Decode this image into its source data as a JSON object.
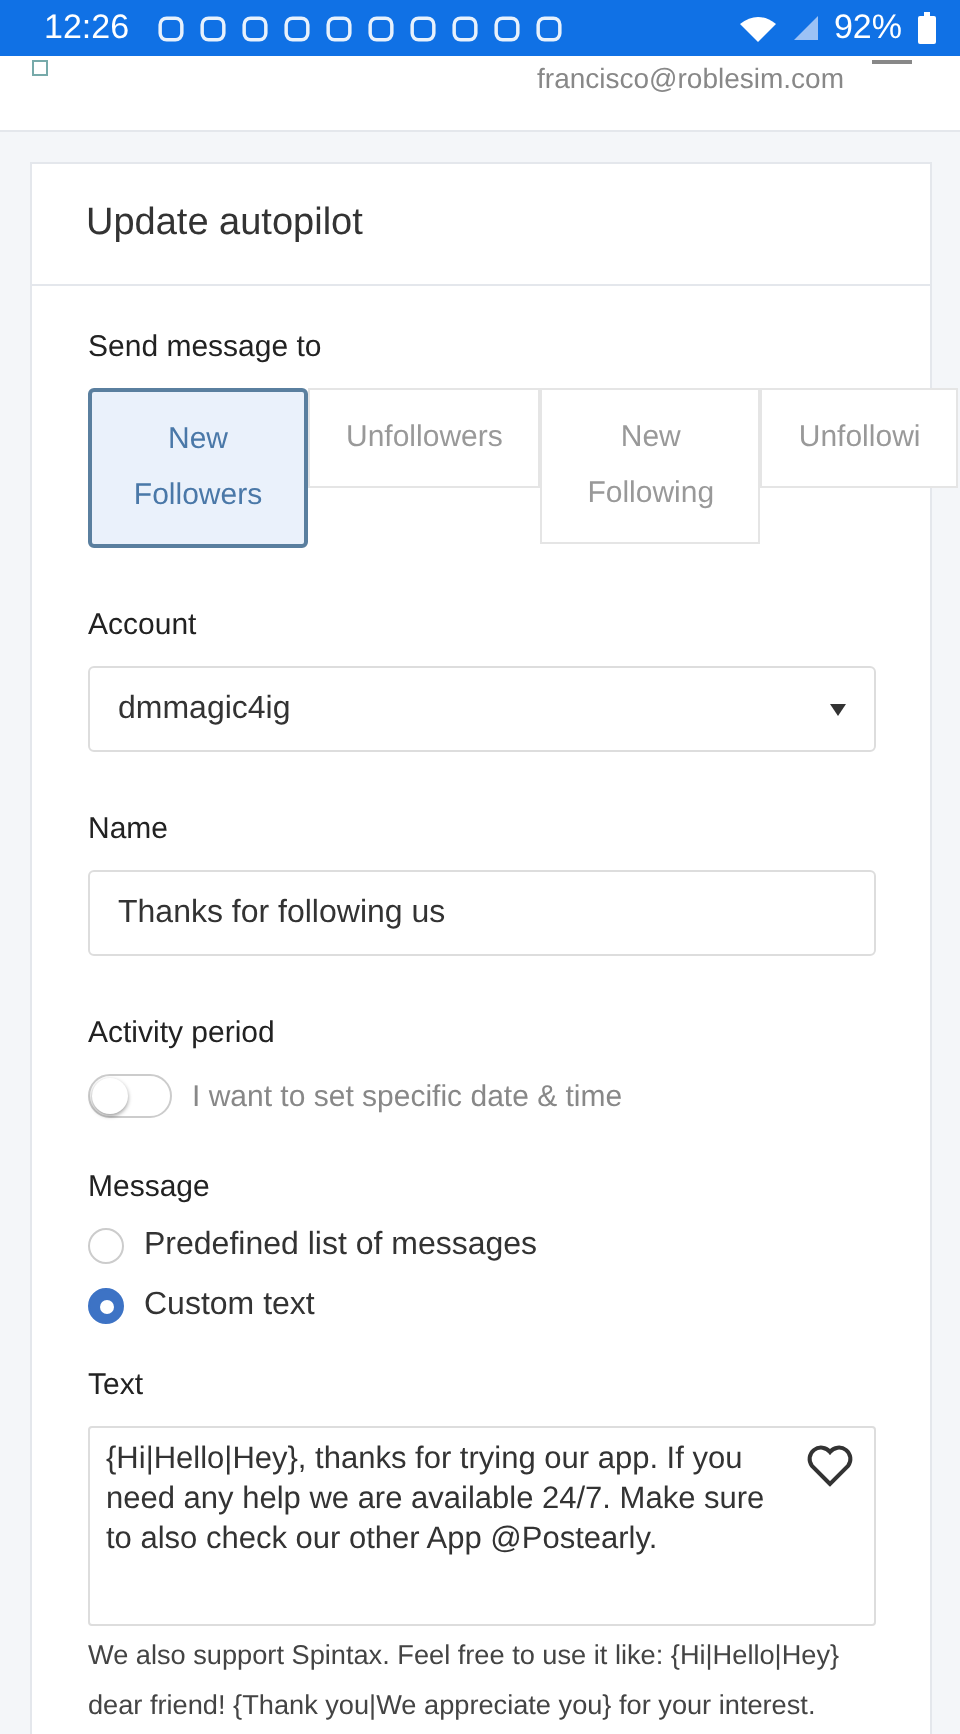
{
  "status_bar": {
    "time": "12:26",
    "battery": "92%"
  },
  "header": {
    "email": "francisco@roblesim.com"
  },
  "card": {
    "title": "Update autopilot",
    "send_to": {
      "label": "Send message to",
      "options": [
        {
          "label": "New Followers",
          "selected": true
        },
        {
          "label": "Unfollowers",
          "selected": false
        },
        {
          "label": "New Following",
          "selected": false
        },
        {
          "label": "Unfollowi",
          "selected": false
        }
      ]
    },
    "account": {
      "label": "Account",
      "value": "dmmagic4ig"
    },
    "name": {
      "label": "Name",
      "value": "Thanks for following us"
    },
    "activity": {
      "label": "Activity period",
      "toggle_label": "I want to set specific date & time",
      "on": false
    },
    "message": {
      "label": "Message",
      "options": [
        {
          "label": "Predefined list of messages",
          "selected": false
        },
        {
          "label": "Custom text",
          "selected": true
        }
      ]
    },
    "text": {
      "label": "Text",
      "value": "{Hi|Hello|Hey}, thanks for trying our app. If you need any help we are available 24/7. Make sure to also check our other App @Postearly.",
      "help": "We also support Spintax. Feel free to use it like: {Hi|Hello|Hey} dear friend! {Thank you|We appreciate you} for your interest."
    }
  }
}
